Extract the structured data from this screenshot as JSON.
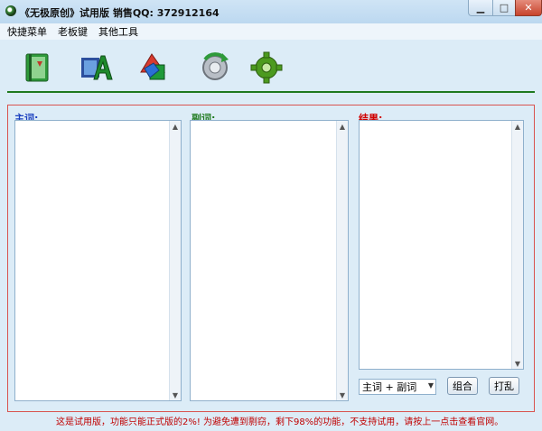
{
  "window": {
    "title": "《无极原创》试用版 销售QQ:  372912164",
    "min_glyph": "▁",
    "max_glyph": "□",
    "close_glyph": "✕"
  },
  "menu": [
    "快捷菜单",
    "老板键",
    "其他工具"
  ],
  "toolbar": {
    "icons": [
      "book-icon",
      "text-style-icon",
      "shapes-icon",
      "refresh-gear-icon",
      "gear-icon"
    ]
  },
  "panels": {
    "main_label": "主词:",
    "secondary_label": "副词:",
    "result_label": "结果:"
  },
  "controls": {
    "mode_select": "主词 + 副词",
    "combine_button": "组合",
    "shuffle_button": "打乱"
  },
  "colors": {
    "main_label": "#1a3fbf",
    "secondary_label": "#1f7a1f",
    "result_label": "#d00000",
    "frame_border": "#d9534f",
    "toolbar_line": "#1f7a1f"
  },
  "notice": "这是试用版，功能只能正式版的2%! 为避免遭到剽窃，剩下98%的功能，不支持试用，请按上一点击查看官网。"
}
